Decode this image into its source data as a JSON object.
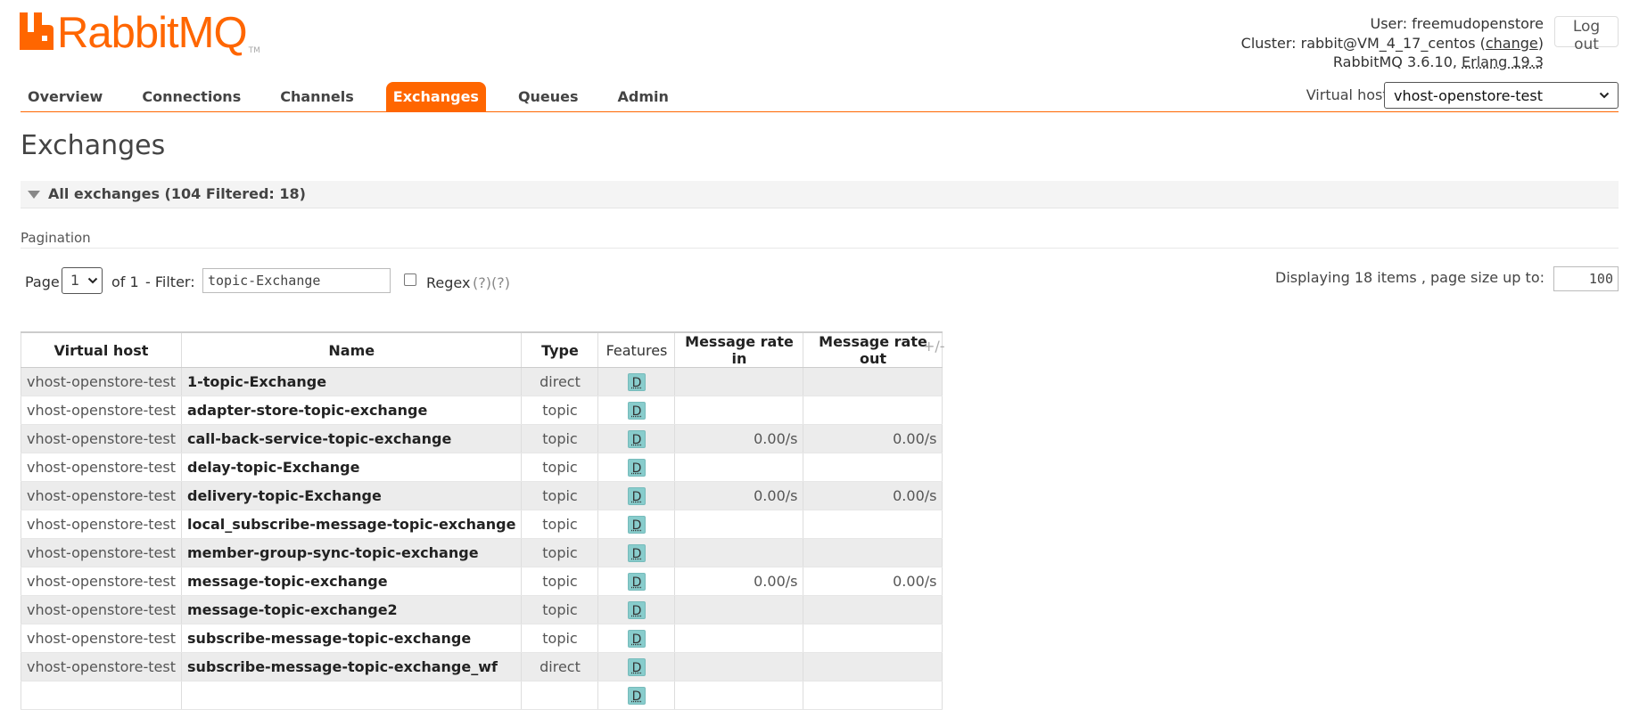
{
  "logo": {
    "text": "RabbitMQ",
    "tm": "TM"
  },
  "header": {
    "user_label": "User:",
    "user": "freemudopenstore",
    "cluster_label": "Cluster:",
    "cluster": "rabbit@VM_4_17_centos",
    "change": "change",
    "version_text": "RabbitMQ 3.6.10,",
    "erlang": "Erlang 19.3",
    "logout": "Log out"
  },
  "nav": {
    "tabs": [
      "Overview",
      "Connections",
      "Channels",
      "Exchanges",
      "Queues",
      "Admin"
    ],
    "active": "Exchanges"
  },
  "vhost": {
    "label": "Virtual host:",
    "selected": "vhost-openstore-test"
  },
  "page_title": "Exchanges",
  "section": {
    "label": "All exchanges (104 Filtered: 18)"
  },
  "pagination": {
    "label": "Pagination",
    "page_label": "Page",
    "page_value": "1",
    "of_text": "of 1",
    "filter_label": "- Filter:",
    "filter_value": "topic-Exchange",
    "regex_label": "Regex",
    "regex_help": "(?)(?)",
    "display_text": "Displaying 18 items , page size up to:",
    "page_size": "100"
  },
  "table": {
    "headers": [
      "Virtual host",
      "Name",
      "Type",
      "Features",
      "Message rate in",
      "Message rate out"
    ],
    "cols_toggle": "+/-",
    "rows": [
      {
        "vhost": "vhost-openstore-test",
        "name": "1-topic-Exchange",
        "type": "direct",
        "feature": "D",
        "rate_in": "",
        "rate_out": ""
      },
      {
        "vhost": "vhost-openstore-test",
        "name": "adapter-store-topic-exchange",
        "type": "topic",
        "feature": "D",
        "rate_in": "",
        "rate_out": ""
      },
      {
        "vhost": "vhost-openstore-test",
        "name": "call-back-service-topic-exchange",
        "type": "topic",
        "feature": "D",
        "rate_in": "0.00/s",
        "rate_out": "0.00/s"
      },
      {
        "vhost": "vhost-openstore-test",
        "name": "delay-topic-Exchange",
        "type": "topic",
        "feature": "D",
        "rate_in": "",
        "rate_out": ""
      },
      {
        "vhost": "vhost-openstore-test",
        "name": "delivery-topic-Exchange",
        "type": "topic",
        "feature": "D",
        "rate_in": "0.00/s",
        "rate_out": "0.00/s"
      },
      {
        "vhost": "vhost-openstore-test",
        "name": "local_subscribe-message-topic-exchange",
        "type": "topic",
        "feature": "D",
        "rate_in": "",
        "rate_out": ""
      },
      {
        "vhost": "vhost-openstore-test",
        "name": "member-group-sync-topic-exchange",
        "type": "topic",
        "feature": "D",
        "rate_in": "",
        "rate_out": ""
      },
      {
        "vhost": "vhost-openstore-test",
        "name": "message-topic-exchange",
        "type": "topic",
        "feature": "D",
        "rate_in": "0.00/s",
        "rate_out": "0.00/s"
      },
      {
        "vhost": "vhost-openstore-test",
        "name": "message-topic-exchange2",
        "type": "topic",
        "feature": "D",
        "rate_in": "",
        "rate_out": ""
      },
      {
        "vhost": "vhost-openstore-test",
        "name": "subscribe-message-topic-exchange",
        "type": "topic",
        "feature": "D",
        "rate_in": "",
        "rate_out": ""
      },
      {
        "vhost": "vhost-openstore-test",
        "name": "subscribe-message-topic-exchange_wf",
        "type": "direct",
        "feature": "D",
        "rate_in": "",
        "rate_out": ""
      },
      {
        "vhost": "",
        "name": "",
        "type": "",
        "feature": "D",
        "rate_in": "",
        "rate_out": ""
      }
    ]
  }
}
